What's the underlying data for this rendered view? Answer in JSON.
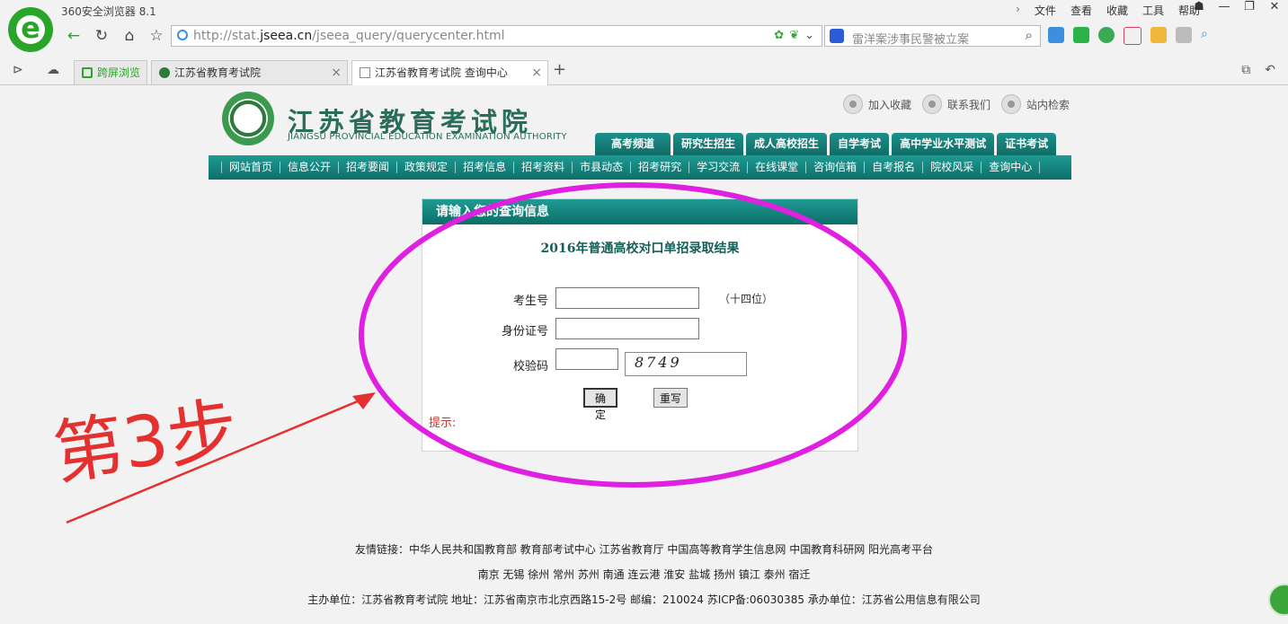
{
  "browser": {
    "title": "360安全浏览器 8.1",
    "menu": [
      "文件",
      "查看",
      "收藏",
      "工具",
      "帮助"
    ],
    "url_prefix": "http://stat.",
    "url_domain": "jseea.cn",
    "url_path": "/jseea_query/querycenter.html",
    "search_placeholder": "雷洋案涉事民警被立案",
    "tabs": [
      {
        "label": "跨屏浏览"
      },
      {
        "label": "江苏省教育考试院"
      },
      {
        "label": "江苏省教育考试院 查询中心"
      }
    ],
    "new_tab": "+",
    "close_glyph": "×"
  },
  "site": {
    "name_cn": "江苏省教育考试院",
    "name_en": "JIANGSU PROVINCIAL EDUCATION EXAMINATION AUTHORITY",
    "top_links": [
      "加入收藏",
      "联系我们",
      "站内检索"
    ],
    "channels": [
      "高考频道",
      "研究生招生",
      "成人高校招生",
      "自学考试",
      "高中学业水平测试",
      "证书考试"
    ],
    "nav": [
      "网站首页",
      "信息公开",
      "招考要闻",
      "政策规定",
      "招考信息",
      "招考资料",
      "市县动态",
      "招考研究",
      "学习交流",
      "在线课堂",
      "咨询信箱",
      "自考报名",
      "院校风采",
      "查询中心"
    ]
  },
  "query": {
    "header": "请输入您的查询信息",
    "title": "2016年普通高校对口单招录取结果",
    "exam_no_label": "考生号",
    "exam_no_value": "",
    "exam_no_hint": "（十四位）",
    "id_label": "身份证号",
    "id_value": "",
    "captcha_label": "校验码",
    "captcha_value": "",
    "captcha_image_text": "8749",
    "submit_label": "确定",
    "reset_label": "重写",
    "tip_label": "提示:"
  },
  "footer": {
    "links_line": "友情链接：中华人民共和国教育部  教育部考试中心  江苏省教育厅  中国高等教育学生信息网  中国教育科研网  阳光高考平台",
    "cities_line": "南京  无锡  徐州  常州  苏州  南通  连云港  淮安  盐城  扬州  镇江  泰州  宿迁",
    "info_line": "主办单位：江苏省教育考试院  地址：江苏省南京市北京西路15-2号  邮编：210024  苏ICP备:06030385    承办单位：江苏省公用信息有限公司"
  },
  "annotation": {
    "handwriting": "第3步",
    "ellipse_color": "#e020e0",
    "arrow_color": "#e53030"
  },
  "colors": {
    "site_teal": "#0e6f69",
    "browser_green": "#2aa52a"
  }
}
